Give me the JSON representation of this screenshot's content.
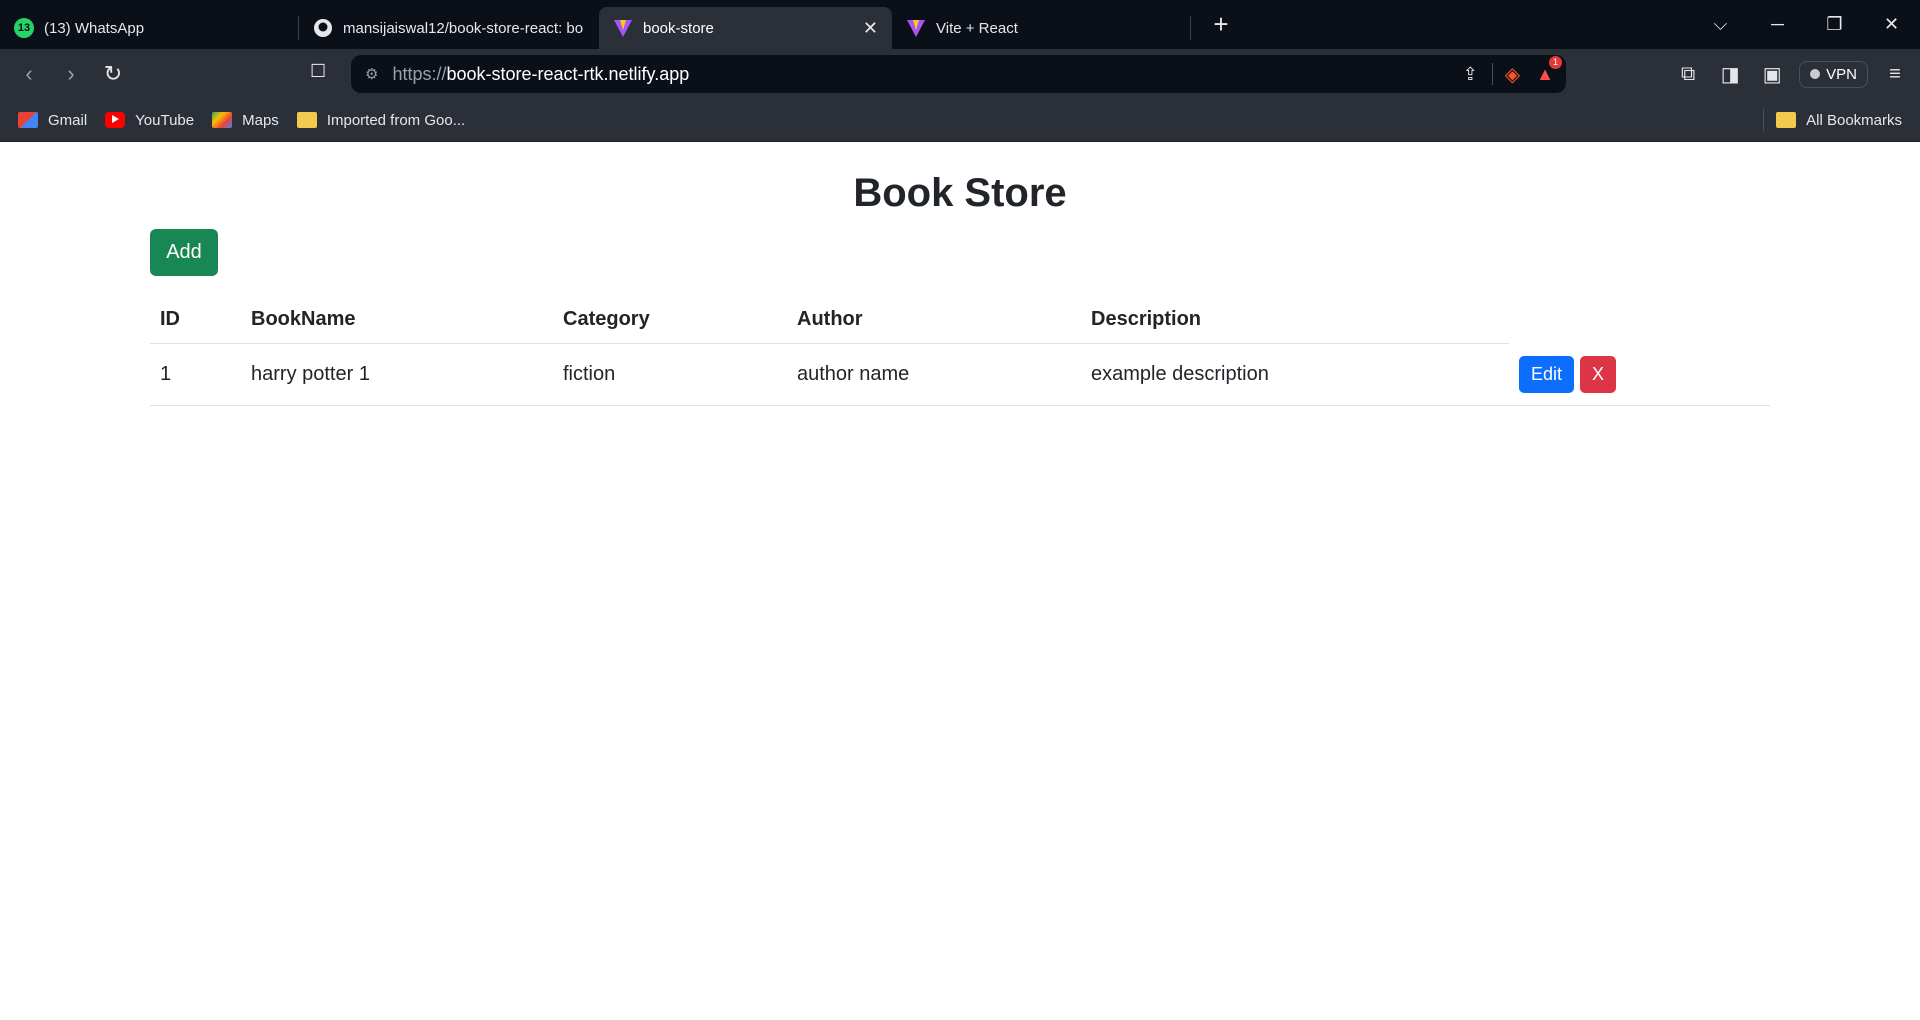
{
  "browser": {
    "tabs": [
      {
        "title": "(13) WhatsApp",
        "badge": "13",
        "icon": "whatsapp-icon"
      },
      {
        "title": "mansijaiswal12/book-store-react: bo",
        "icon": "github-icon"
      },
      {
        "title": "book-store",
        "icon": "vite-icon",
        "active": true
      },
      {
        "title": "Vite + React",
        "icon": "vite-icon"
      }
    ],
    "url_protocol": "https://",
    "url_host": "book-store-react-rtk.netlify.app",
    "vpn_label": "VPN",
    "bookmarks": [
      {
        "label": "Gmail",
        "icon": "gmail-icon"
      },
      {
        "label": "YouTube",
        "icon": "youtube-icon"
      },
      {
        "label": "Maps",
        "icon": "maps-icon"
      },
      {
        "label": "Imported from Goo...",
        "icon": "folder-icon"
      }
    ],
    "all_bookmarks_label": "All Bookmarks",
    "notification_count": "1"
  },
  "page": {
    "title": "Book Store",
    "add_label": "Add",
    "table": {
      "headers": [
        "ID",
        "BookName",
        "Category",
        "Author",
        "Description"
      ],
      "rows": [
        {
          "id": "1",
          "name": "harry potter 1",
          "category": "fiction",
          "author": "author name",
          "description": "example description"
        }
      ],
      "edit_label": "Edit",
      "delete_label": "X"
    }
  },
  "colors": {
    "add_button": "#198754",
    "edit_button": "#0d6efd",
    "delete_button": "#dc3545",
    "chrome_dark": "#0b0f17",
    "chrome_mid": "#2b3038"
  }
}
